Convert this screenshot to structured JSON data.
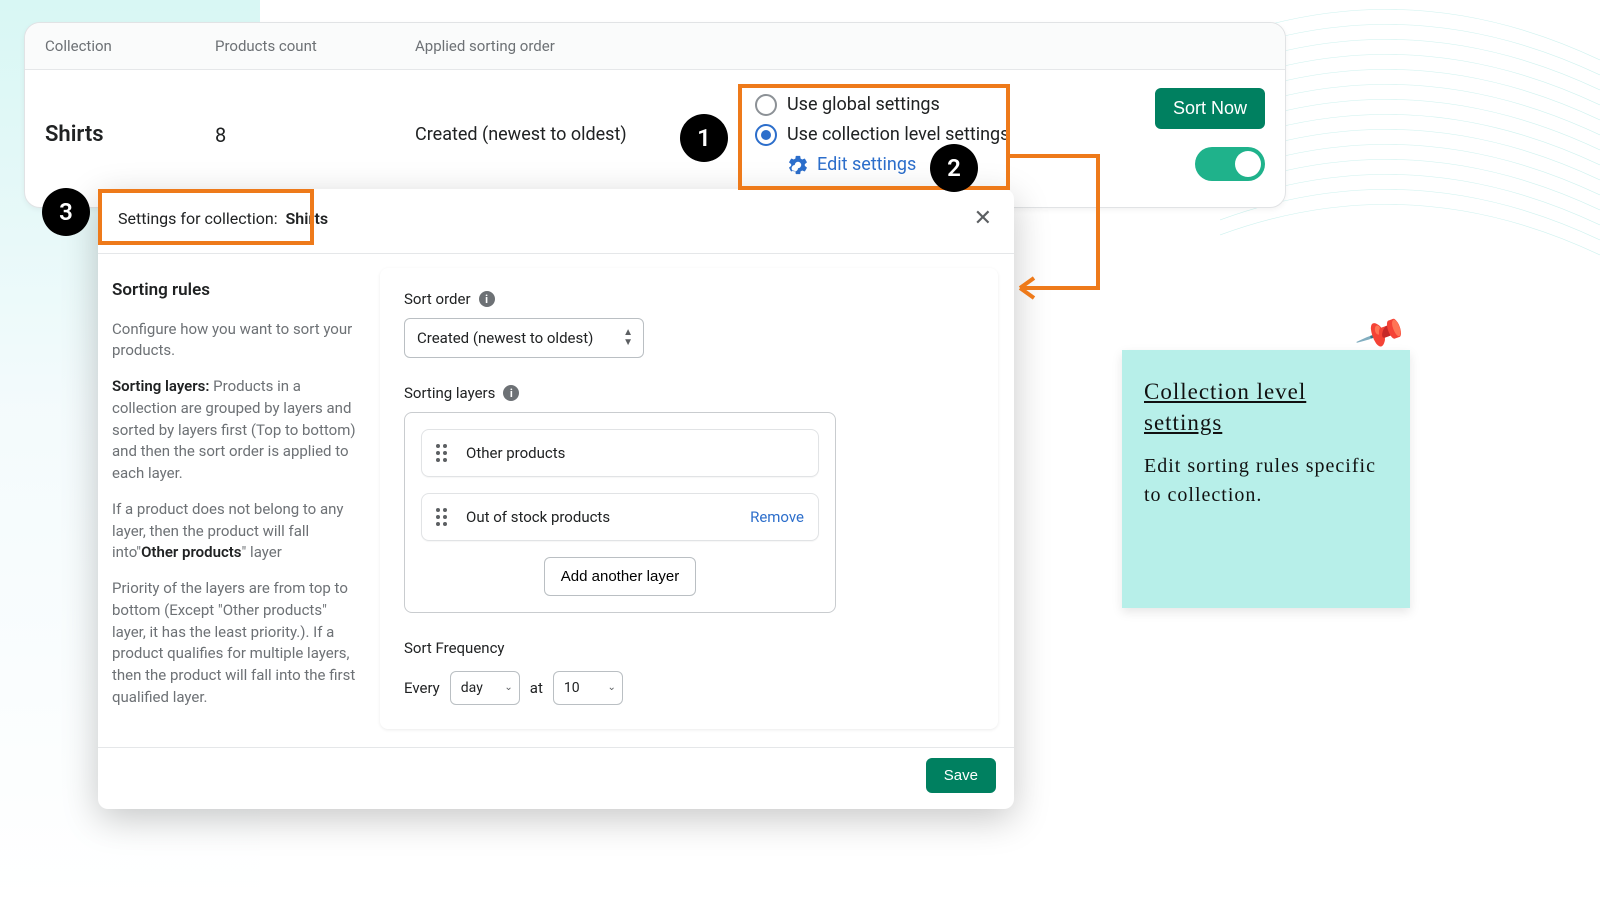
{
  "table": {
    "headers": {
      "collection": "Collection",
      "count": "Products count",
      "sort": "Applied sorting order"
    },
    "row": {
      "collection": "Shirts",
      "count": "8",
      "sort": "Created (newest to oldest)"
    }
  },
  "settings_radio": {
    "global": "Use global settings",
    "collection": "Use collection level settings",
    "edit": "Edit settings"
  },
  "actions": {
    "sort_now": "Sort Now"
  },
  "badges": {
    "one": "1",
    "two": "2",
    "three": "3"
  },
  "modal": {
    "title_prefix": "Settings for collection:",
    "title_name": "Shirts",
    "side": {
      "heading": "Sorting rules",
      "p1": "Configure how you want to sort your products.",
      "p2a": "Sorting layers:",
      "p2b": " Products in a collection are grouped by layers and sorted by layers first (Top to bottom) and then the sort order is applied to each layer.",
      "p3a": "If a product does not belong to any layer, then the product will fall into\"",
      "p3b": "Other products",
      "p3c": "\" layer",
      "p4": "Priority of the layers are from top to bottom (Except \"Other products\" layer, it has the least priority.). If a product qualifies for multiple layers, then the product will fall into the first qualified layer."
    },
    "sort_order_label": "Sort order",
    "sort_order_value": "Created (newest to oldest)",
    "sorting_layers_label": "Sorting layers",
    "layers": {
      "other": "Other products",
      "oos": "Out of stock products",
      "remove": "Remove",
      "add": "Add another layer"
    },
    "freq": {
      "label": "Sort Frequency",
      "every": "Every",
      "unit": "day",
      "at": "at",
      "hour": "10"
    },
    "save": "Save"
  },
  "note": {
    "title": "Collection level settings",
    "body": "Edit sorting rules specific to collection."
  }
}
